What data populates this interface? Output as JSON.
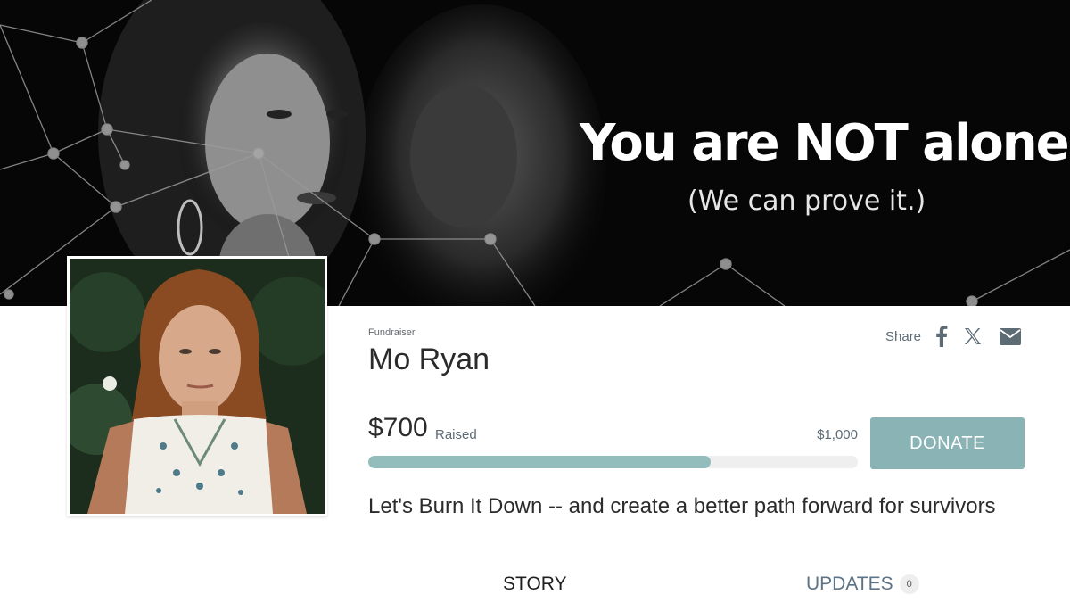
{
  "banner": {
    "headline": "You are NOT alone.",
    "subheadline": "(We can prove it.)"
  },
  "fundraiser": {
    "kind_label": "Fundraiser",
    "name": "Mo Ryan",
    "tagline": "Let's Burn It Down -- and create a better path forward for survivors"
  },
  "share": {
    "label": "Share",
    "icons": [
      "facebook-icon",
      "x-icon",
      "email-icon"
    ]
  },
  "progress": {
    "raised": "$700",
    "raised_label": "Raised",
    "goal": "$1,000",
    "percent": 70
  },
  "donate": {
    "label": "DONATE"
  },
  "tabs": {
    "story": "STORY",
    "updates": "UPDATES",
    "updates_count": "0"
  },
  "colors": {
    "accent": "#8ab3b5",
    "progress_fill": "#93bcbd",
    "progress_track": "#efefef",
    "banner_bg": "#060606",
    "muted_text": "#5d6b75"
  }
}
